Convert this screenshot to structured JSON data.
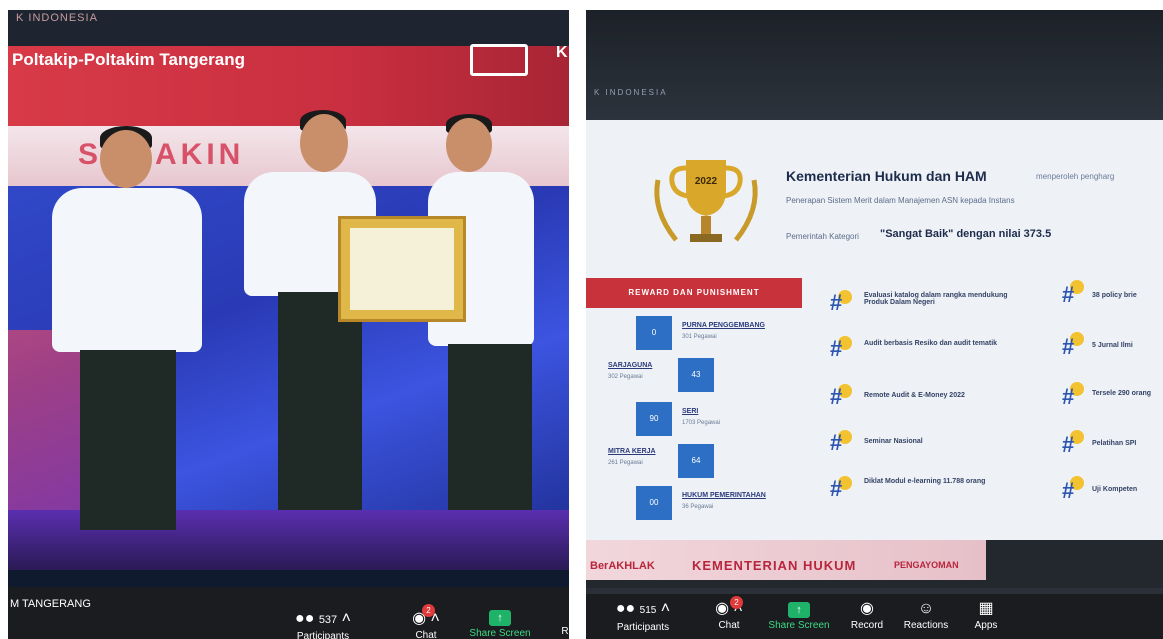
{
  "left": {
    "stage_corner": "K INDONESIA",
    "banner_title": "Poltakip-Poltakim Tangerang",
    "banner_right": "K",
    "sub_banner": "SEMAKIN",
    "participant_name": "M TANGERANG",
    "toolbar": {
      "participants_count": "537",
      "participants_label": "Participants",
      "chat_label": "Chat",
      "chat_badge": "2",
      "share_label": "Share Screen",
      "more_label": "R"
    }
  },
  "right": {
    "top_label": "K INDONESIA",
    "slide": {
      "title": "Kementerian Hukum dan HAM",
      "title_tail": "menperoleh pengharg",
      "line1": "Penerapan Sistem Merit dalam Manajemen ASN kepada Instans",
      "line2": "Pemerintah Kategori",
      "category": "\"Sangat Baik\" dengan nilai 373.5",
      "trophy_year": "2022",
      "rp_header": "REWARD DAN PUNISHMENT",
      "rp_rows": [
        {
          "num": "0",
          "label": "PURNA PENGGEMBANG",
          "sub": "301 Pegawai"
        },
        {
          "num": "43",
          "label": "SARJAGUNA",
          "sub": "302 Pegawai"
        },
        {
          "num": "90",
          "label": "SERI",
          "sub": "1703 Pegawai"
        },
        {
          "num": "64",
          "label": "MITRA KERJA",
          "sub": "261 Pegawai"
        },
        {
          "num": "00",
          "label": "HUKUM PEMERINTAHAN",
          "sub": "36 Pegawai"
        }
      ],
      "items_col1": [
        "Evaluasi katalog dalam rangka mendukung Produk Dalam Negeri",
        "Audit berbasis Resiko dan audit tematik",
        "Remote Audit & E-Money 2022",
        "Seminar Nasional",
        "Diklat Modul e-learning 11.788 orang"
      ],
      "items_col2": [
        "38 policy brie",
        "5 Jurnal Ilmi",
        "Tersele 290 orang",
        "Pelatihan SPI",
        "Uji Kompeten"
      ],
      "footer_left": "BerAKHLAK",
      "footer_mid": "KEMENTERIAN HUKUM",
      "footer_right": "PENGAYOMAN"
    },
    "toolbar": {
      "participants_count": "515",
      "participants_label": "Participants",
      "chat_label": "Chat",
      "chat_badge": "2",
      "share_label": "Share Screen",
      "record_label": "Record",
      "reactions_label": "Reactions",
      "apps_label": "Apps"
    }
  }
}
